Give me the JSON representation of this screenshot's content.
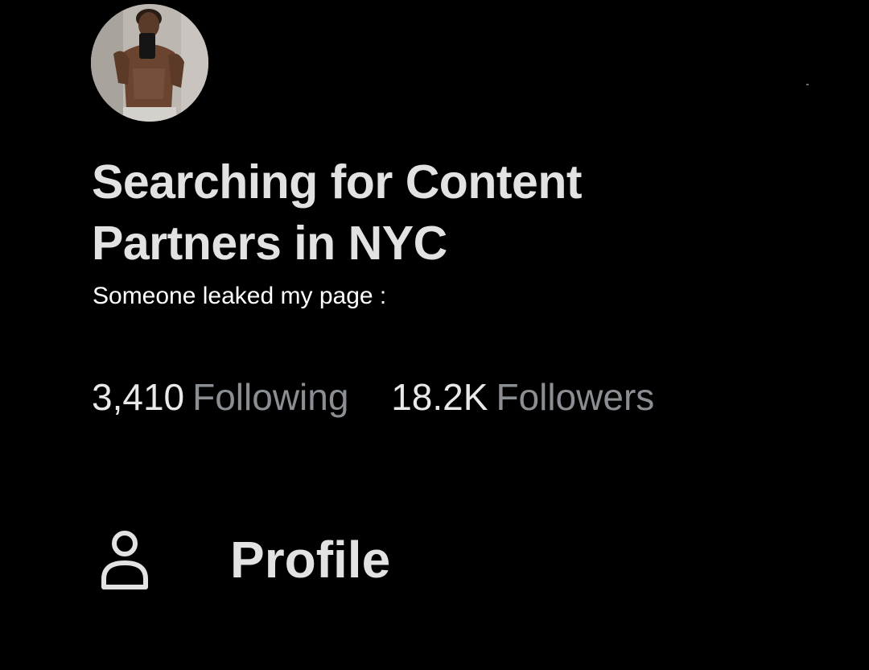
{
  "profile": {
    "display_name": "Searching for Content Partners in NYC",
    "bio": "Someone leaked my page :",
    "avatar_icon": "profile-photo"
  },
  "stats": {
    "following_count": "3,410",
    "following_label": "Following",
    "followers_count": "18.2K",
    "followers_label": "Followers"
  },
  "nav": {
    "profile_label": "Profile",
    "profile_icon": "person-icon"
  },
  "colors": {
    "background": "#000000",
    "primary_text": "#e7e9ea",
    "secondary_text": "#8b8f93"
  }
}
